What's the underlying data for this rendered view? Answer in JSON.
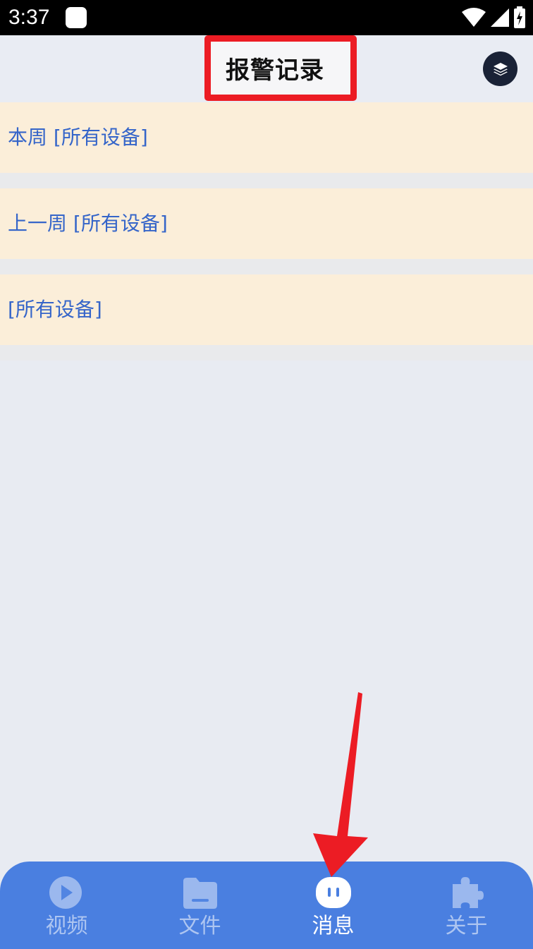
{
  "status_bar": {
    "time": "3:37"
  },
  "header": {
    "title": "报警记录",
    "layers_icon": "layers-icon"
  },
  "list": {
    "items": [
      {
        "label": "本周 [所有设备]"
      },
      {
        "label": "上一周 [所有设备]"
      },
      {
        "label": "[所有设备]"
      }
    ]
  },
  "bottom_nav": {
    "active": "消息",
    "tabs": [
      {
        "label": "视频",
        "icon": "play-icon"
      },
      {
        "label": "文件",
        "icon": "folder-icon"
      },
      {
        "label": "消息",
        "icon": "message-icon"
      },
      {
        "label": "关于",
        "icon": "puzzle-icon"
      }
    ]
  },
  "colors": {
    "accent": "#4a7fe0",
    "list_bg": "#fbeed9",
    "list_text": "#3565c9",
    "highlight": "#ec1c24"
  }
}
